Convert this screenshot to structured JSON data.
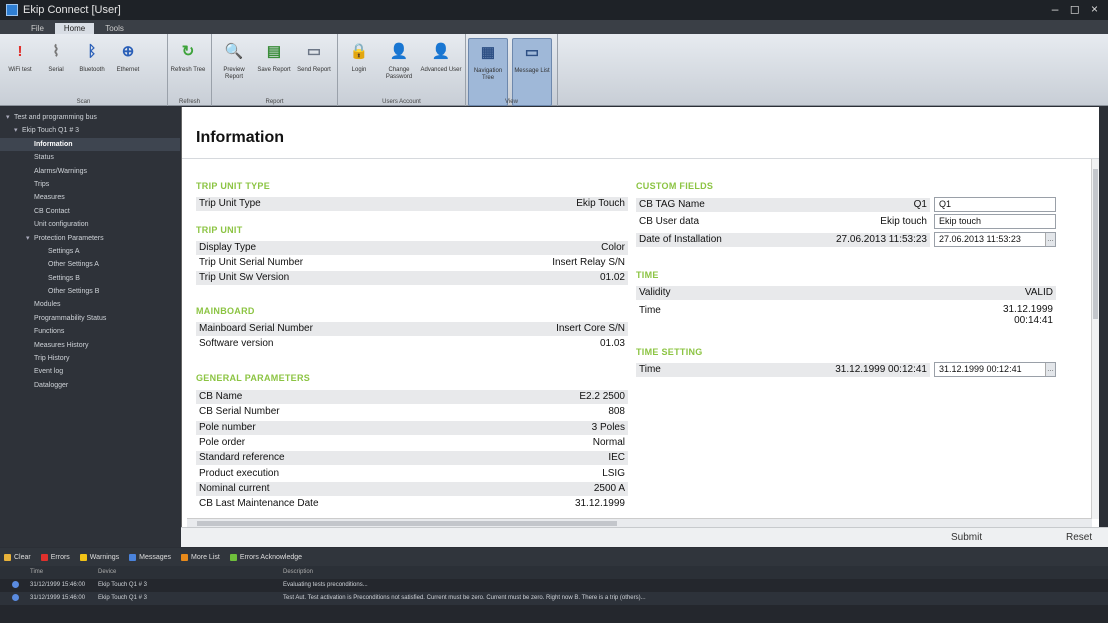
{
  "window": {
    "title": "Ekip Connect [User]",
    "controls": "– ◻ ×"
  },
  "ribbon": {
    "tabs": [
      "File",
      "Home",
      "Tools"
    ],
    "groups": [
      {
        "label": "Scan",
        "buttons": [
          "WiFi test",
          "Serial",
          "Bluetooth",
          "Ethernet"
        ]
      },
      {
        "label": "Refresh",
        "buttons": [
          "Refresh Tree"
        ]
      },
      {
        "label": "Report",
        "buttons": [
          "Preview Report",
          "Save Report",
          "Send Report"
        ]
      },
      {
        "label": "Users Account",
        "buttons": [
          "Login",
          "Change Password",
          "Advanced User"
        ]
      },
      {
        "label": "View",
        "buttons": [
          "Navigation Tree",
          "Message List"
        ]
      }
    ]
  },
  "tree": [
    "Test and programming bus",
    "Ekip Touch Q1 # 3",
    "Information",
    "Status",
    "Alarms/Warnings",
    "Trips",
    "Measures",
    "CB Contact",
    "Unit configuration",
    "Protection Parameters",
    "Settings A",
    "Other Settings A",
    "Settings B",
    "Other Settings B",
    "Modules",
    "Programmability Status",
    "Functions",
    "Measures History",
    "Trip History",
    "Event log",
    "Datalogger"
  ],
  "info": {
    "title": "Information",
    "trip_unit_type": {
      "heading": "TRIP UNIT TYPE",
      "rows": [
        [
          "Trip Unit Type",
          "Ekip Touch"
        ]
      ]
    },
    "trip_unit": {
      "heading": "TRIP UNIT",
      "rows": [
        [
          "Display Type",
          "Color"
        ],
        [
          "Trip Unit Serial Number",
          "Insert Relay S/N"
        ],
        [
          "Trip Unit Sw Version",
          "01.02"
        ]
      ]
    },
    "mainboard": {
      "heading": "MAINBOARD",
      "rows": [
        [
          "Mainboard Serial Number",
          "Insert Core S/N"
        ],
        [
          "Software version",
          "01.03"
        ]
      ]
    },
    "general": {
      "heading": "GENERAL PARAMETERS",
      "rows": [
        [
          "CB Name",
          "E2.2 2500"
        ],
        [
          "CB Serial Number",
          "808"
        ],
        [
          "Pole number",
          "3 Poles"
        ],
        [
          "Pole order",
          "Normal"
        ],
        [
          "Standard reference",
          "IEC"
        ],
        [
          "Product execution",
          "LSIG"
        ],
        [
          "Nominal current",
          "2500 A"
        ],
        [
          "CB Last Maintenance Date",
          "31.12.1999"
        ]
      ]
    },
    "custom": {
      "heading": "CUSTOM FIELDS",
      "rows": [
        [
          "CB TAG Name",
          "Q1",
          "Q1"
        ],
        [
          "CB User data",
          "Ekip touch",
          "Ekip touch"
        ],
        [
          "Date of Installation",
          "27.06.2013 11:53:23",
          "27.06.2013 11:53:23"
        ]
      ]
    },
    "time": {
      "heading": "TIME",
      "rows": [
        [
          "Validity",
          "VALID"
        ],
        [
          "Time",
          "31.12.1999 00:14:41"
        ]
      ]
    },
    "time_setting": {
      "heading": "TIME SETTING",
      "rows": [
        [
          "Time",
          "31.12.1999 00:12:41",
          "31.12.1999 00:12:41"
        ]
      ]
    }
  },
  "actions": {
    "submit": "Submit",
    "reset": "Reset"
  },
  "log": {
    "tabs": [
      "Clear",
      "Errors",
      "Warnings",
      "Messages",
      "More List",
      "Errors Acknowledge"
    ],
    "columns": [
      "Time",
      "Device",
      "Description"
    ],
    "rows": [
      {
        "time": "31/12/1999 15:46:00",
        "device": "Ekip Touch Q1 # 3",
        "desc": "Evaluating tests preconditions..."
      },
      {
        "time": "31/12/1999 15:46:00",
        "device": "Ekip Touch Q1 # 3",
        "desc": "Test Aut. Test activation is Preconditions not satisfied. Current must be zero. Current must be zero. Right now B. There is a trip (others)..."
      }
    ]
  },
  "colors": {
    "accent": "#8cc443",
    "tree_bg": "#2e3239",
    "ribbon_sel": "#9fb8d8"
  }
}
